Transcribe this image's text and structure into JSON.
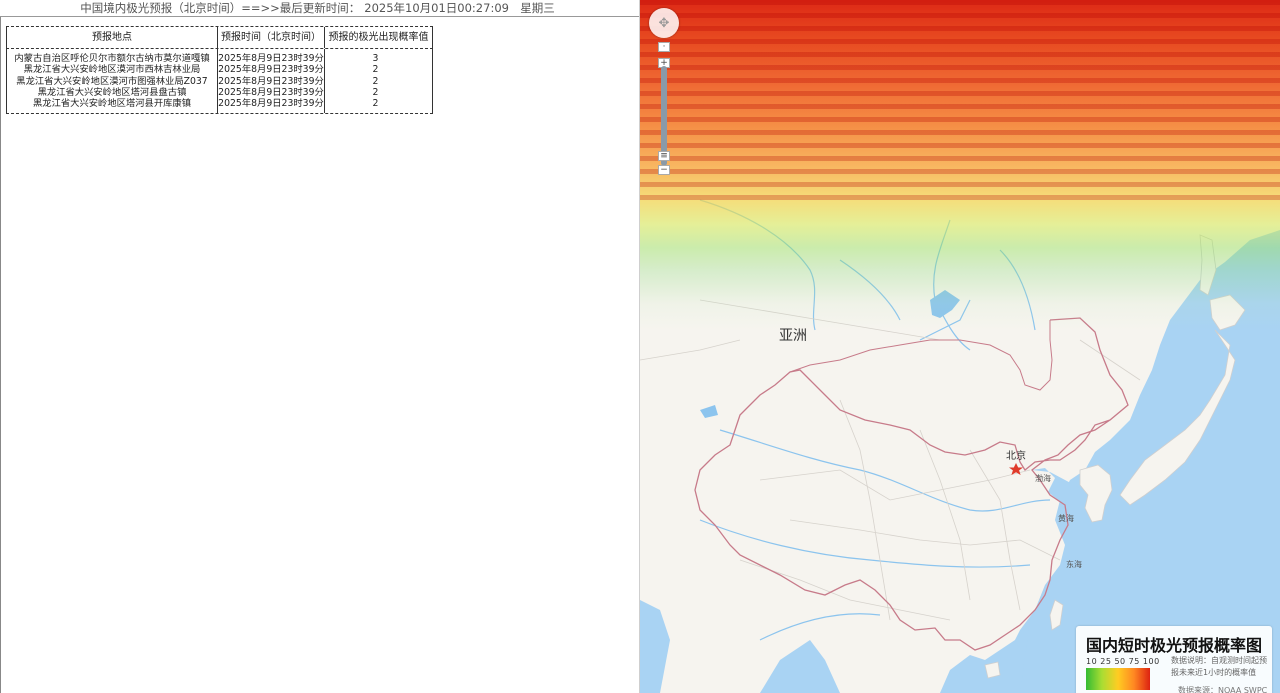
{
  "header": {
    "title": "中国境内极光预报（北京时间）==>>最后更新时间：",
    "updated": "2025年10月01日00:27:09",
    "weekday": "星期三"
  },
  "table": {
    "columns": [
      "预报地点",
      "预报时间（北京时间）",
      "预报的极光出现概率值"
    ],
    "rows": [
      {
        "place": "内蒙古自治区呼伦贝尔市额尔古纳市莫尔道嘎镇",
        "time": "2025年8月9日23时39分",
        "value": "3"
      },
      {
        "place": "黑龙江省大兴安岭地区漠河市西林吉林业局",
        "time": "2025年8月9日23时39分",
        "value": "2"
      },
      {
        "place": "黑龙江省大兴安岭地区漠河市图强林业局Z037",
        "time": "2025年8月9日23时39分",
        "value": "2"
      },
      {
        "place": "黑龙江省大兴安岭地区塔河县盘古镇",
        "time": "2025年8月9日23时39分",
        "value": "2"
      },
      {
        "place": "黑龙江省大兴安岭地区塔河县开库康镇",
        "time": "2025年8月9日23时39分",
        "value": "2"
      }
    ]
  },
  "map": {
    "labels": {
      "continent": "亚洲",
      "capital": "北京",
      "bohai": "渤海",
      "yellow_sea": "黄海",
      "east_sea": "东海"
    },
    "zoom": {
      "plus": "+",
      "minus": "−"
    },
    "colors": {
      "land": "#f6f4ef",
      "water": "#a9d3f3",
      "border": "#c77b8a",
      "province_line": "#cfcfcf",
      "river": "#8cc4ee",
      "capital_star": "#e03a2a"
    }
  },
  "legend": {
    "title": "国内短时极光预报概率图",
    "ticks": "10  25  50  75  100",
    "note": "数据说明：自观测时间起预报未来近1小时的概率值",
    "source": "数据来源：NOAA SWPC"
  }
}
